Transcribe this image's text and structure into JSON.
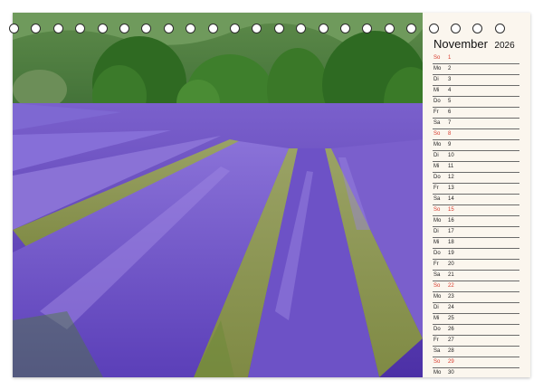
{
  "calendar": {
    "month": "November",
    "year": "2026",
    "days": [
      {
        "wd": "So",
        "num": "1",
        "weekend": true
      },
      {
        "wd": "Mo",
        "num": "2",
        "weekend": false
      },
      {
        "wd": "Di",
        "num": "3",
        "weekend": false
      },
      {
        "wd": "Mi",
        "num": "4",
        "weekend": false
      },
      {
        "wd": "Do",
        "num": "5",
        "weekend": false
      },
      {
        "wd": "Fr",
        "num": "6",
        "weekend": false
      },
      {
        "wd": "Sa",
        "num": "7",
        "weekend": false
      },
      {
        "wd": "So",
        "num": "8",
        "weekend": true
      },
      {
        "wd": "Mo",
        "num": "9",
        "weekend": false
      },
      {
        "wd": "Di",
        "num": "10",
        "weekend": false
      },
      {
        "wd": "Mi",
        "num": "11",
        "weekend": false
      },
      {
        "wd": "Do",
        "num": "12",
        "weekend": false
      },
      {
        "wd": "Fr",
        "num": "13",
        "weekend": false
      },
      {
        "wd": "Sa",
        "num": "14",
        "weekend": false
      },
      {
        "wd": "So",
        "num": "15",
        "weekend": true
      },
      {
        "wd": "Mo",
        "num": "16",
        "weekend": false
      },
      {
        "wd": "Di",
        "num": "17",
        "weekend": false
      },
      {
        "wd": "Mi",
        "num": "18",
        "weekend": false
      },
      {
        "wd": "Do",
        "num": "19",
        "weekend": false
      },
      {
        "wd": "Fr",
        "num": "20",
        "weekend": false
      },
      {
        "wd": "Sa",
        "num": "21",
        "weekend": false
      },
      {
        "wd": "So",
        "num": "22",
        "weekend": true
      },
      {
        "wd": "Mo",
        "num": "23",
        "weekend": false
      },
      {
        "wd": "Di",
        "num": "24",
        "weekend": false
      },
      {
        "wd": "Mi",
        "num": "25",
        "weekend": false
      },
      {
        "wd": "Do",
        "num": "26",
        "weekend": false
      },
      {
        "wd": "Fr",
        "num": "27",
        "weekend": false
      },
      {
        "wd": "Sa",
        "num": "28",
        "weekend": false
      },
      {
        "wd": "So",
        "num": "29",
        "weekend": true
      },
      {
        "wd": "Mo",
        "num": "30",
        "weekend": false
      }
    ]
  },
  "colors": {
    "weekend": "#d83a2c",
    "lavender": "#6a4fc4",
    "foliage": "#3e7a2a",
    "paper": "#fbf6ee"
  },
  "binding": {
    "ring_count": 23
  }
}
